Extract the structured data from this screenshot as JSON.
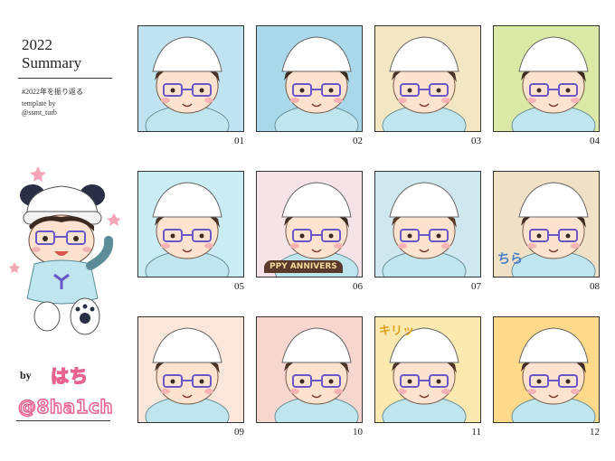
{
  "header": {
    "year": "2022",
    "title": "Summary",
    "hashtag": "#2022年を振り返る",
    "template_line1": "template by",
    "template_line2": "@ssmt_turb"
  },
  "author": {
    "by": "by",
    "name": "はち",
    "handle": "@8ha1ch"
  },
  "tiles": [
    {
      "number": "01",
      "background": "#bfe3f0",
      "text": ""
    },
    {
      "number": "02",
      "background": "#a8d8ea",
      "text": ""
    },
    {
      "number": "03",
      "background": "#f3e6c2",
      "text": ""
    },
    {
      "number": "04",
      "background": "#dbe9a6",
      "text": ""
    },
    {
      "number": "05",
      "background": "#c9ecf5",
      "text": ""
    },
    {
      "number": "06",
      "background": "#f6e3e8",
      "text": "PPY ANNIVERS"
    },
    {
      "number": "07",
      "background": "#cfe8f0",
      "text": ""
    },
    {
      "number": "08",
      "background": "#f0e0c6",
      "text": "ちら"
    },
    {
      "number": "09",
      "background": "#fbe6dc",
      "text": ""
    },
    {
      "number": "10",
      "background": "#f7d6d0",
      "text": ""
    },
    {
      "number": "11",
      "background": "#fbe9b0",
      "text": "キリッ"
    },
    {
      "number": "12",
      "background": "#ffd98a",
      "text": ""
    }
  ]
}
